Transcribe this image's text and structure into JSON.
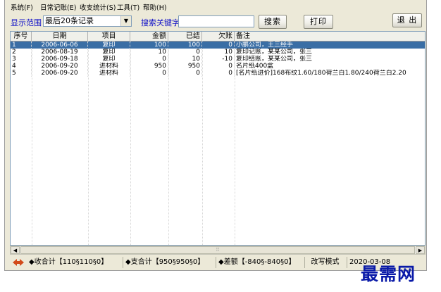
{
  "menu": [
    "系统(F)",
    "日常记账(E)",
    "收支统计(S)",
    "工具(T)",
    "帮助(H)"
  ],
  "toolbar": {
    "range_label": "显示范围",
    "range_value": "最后20条记录",
    "search_label": "搜索关键字",
    "search_value": "",
    "search_button": "搜索",
    "print_button": "打印",
    "exit_button": "退 出"
  },
  "table": {
    "columns": [
      "序号",
      "日期",
      "项目",
      "金额",
      "已结",
      "欠账",
      "备注"
    ],
    "rows": [
      {
        "no": "1",
        "date": "2006-06-06",
        "item": "复印",
        "amount": "100",
        "paid": "100",
        "owed": "0",
        "note": "小鹏公司，王三经手"
      },
      {
        "no": "2",
        "date": "2006-08-19",
        "item": "复印",
        "amount": "10",
        "paid": "0",
        "owed": "10",
        "note": "复印记账，某某公司，张三"
      },
      {
        "no": "3",
        "date": "2006-09-18",
        "item": "复印",
        "amount": "0",
        "paid": "10",
        "owed": "-10",
        "note": "复印结账，某某公司，张三"
      },
      {
        "no": "4",
        "date": "2006-09-20",
        "item": "进材料",
        "amount": "950",
        "paid": "950",
        "owed": "0",
        "note": "名片纸400盒"
      },
      {
        "no": "5",
        "date": "2006-09-20",
        "item": "进材料",
        "amount": "0",
        "paid": "0",
        "owed": "0",
        "note": "[名片纸进价]168布纹1.60/180荷兰白1.80/240荷兰白2.20"
      }
    ],
    "selected_row": 0
  },
  "status": {
    "income": "◆收合计【110§110§0】",
    "expense": "◆支合计【950§950§0】",
    "diff": "◆差额【-840§-840§0】",
    "mode": "改写模式",
    "datetime": "2020-03-08"
  },
  "watermark": "最需网",
  "colors": {
    "selection": "#3a6ea5",
    "label_blue": "#1010c8",
    "watermark": "#0a1aa8"
  }
}
